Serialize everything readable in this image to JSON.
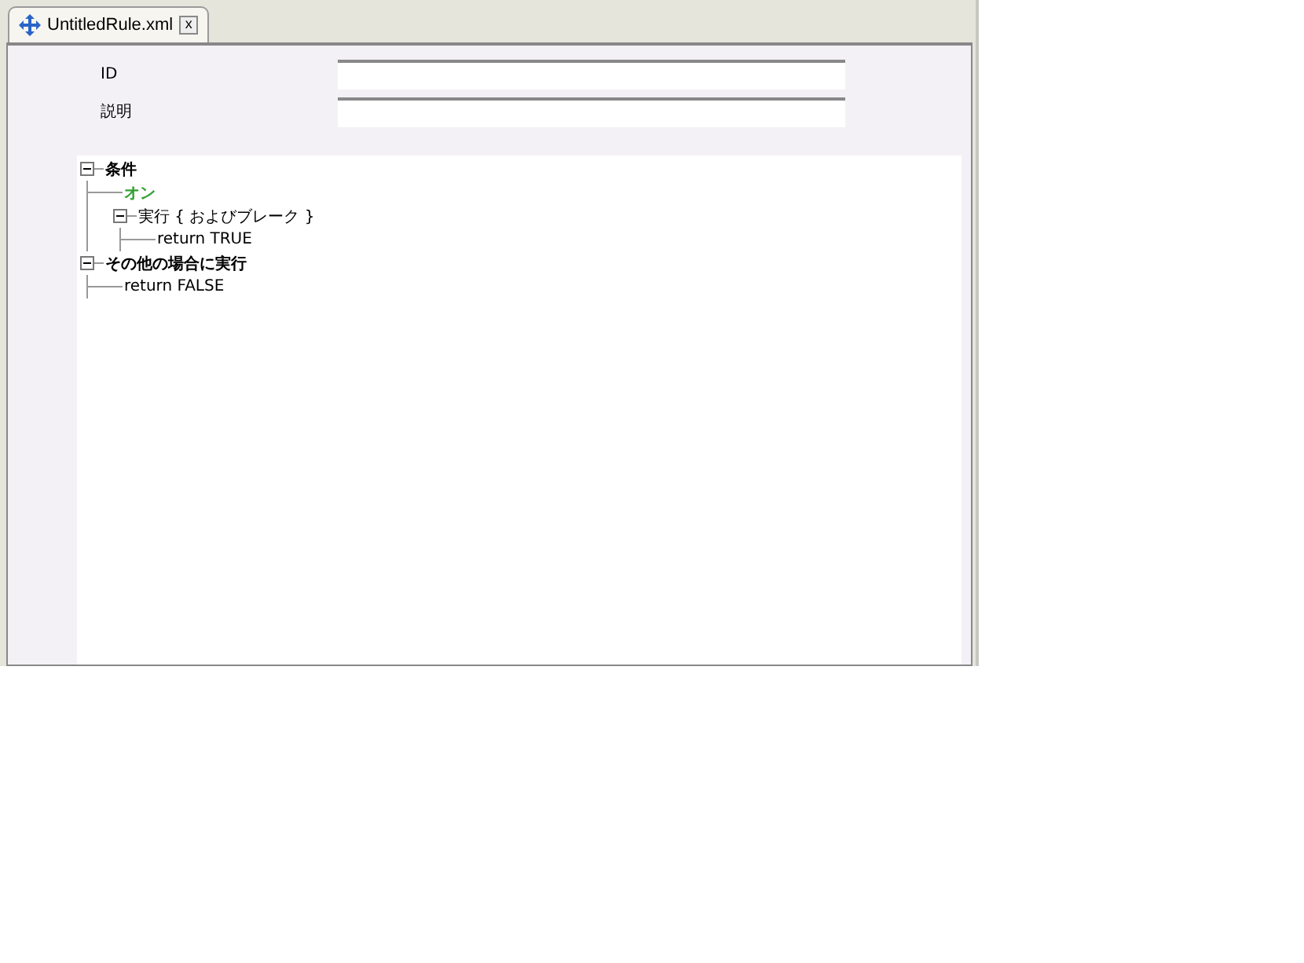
{
  "tab": {
    "title": "UntitledRule.xml",
    "close": "x",
    "selected": true
  },
  "fields": [
    {
      "label": "ID"
    },
    {
      "label": "説明"
    }
  ],
  "tree": [
    {
      "label": "条件",
      "bold": true,
      "color": "#000000",
      "expanded": true,
      "children": [
        {
          "label": "オン",
          "bold": true,
          "color": "#33a033"
        },
        {
          "label": "実行 { およびブレーク }",
          "bold": false,
          "color": "#000000",
          "expanded": true,
          "children": [
            {
              "label": "return TRUE",
              "bold": false,
              "color": "#000000"
            }
          ]
        }
      ]
    },
    {
      "label": "その他の場合に実行",
      "bold": true,
      "color": "#000000",
      "expanded": true,
      "children": [
        {
          "label": "return FALSE",
          "bold": false,
          "color": "#000000"
        }
      ]
    }
  ]
}
